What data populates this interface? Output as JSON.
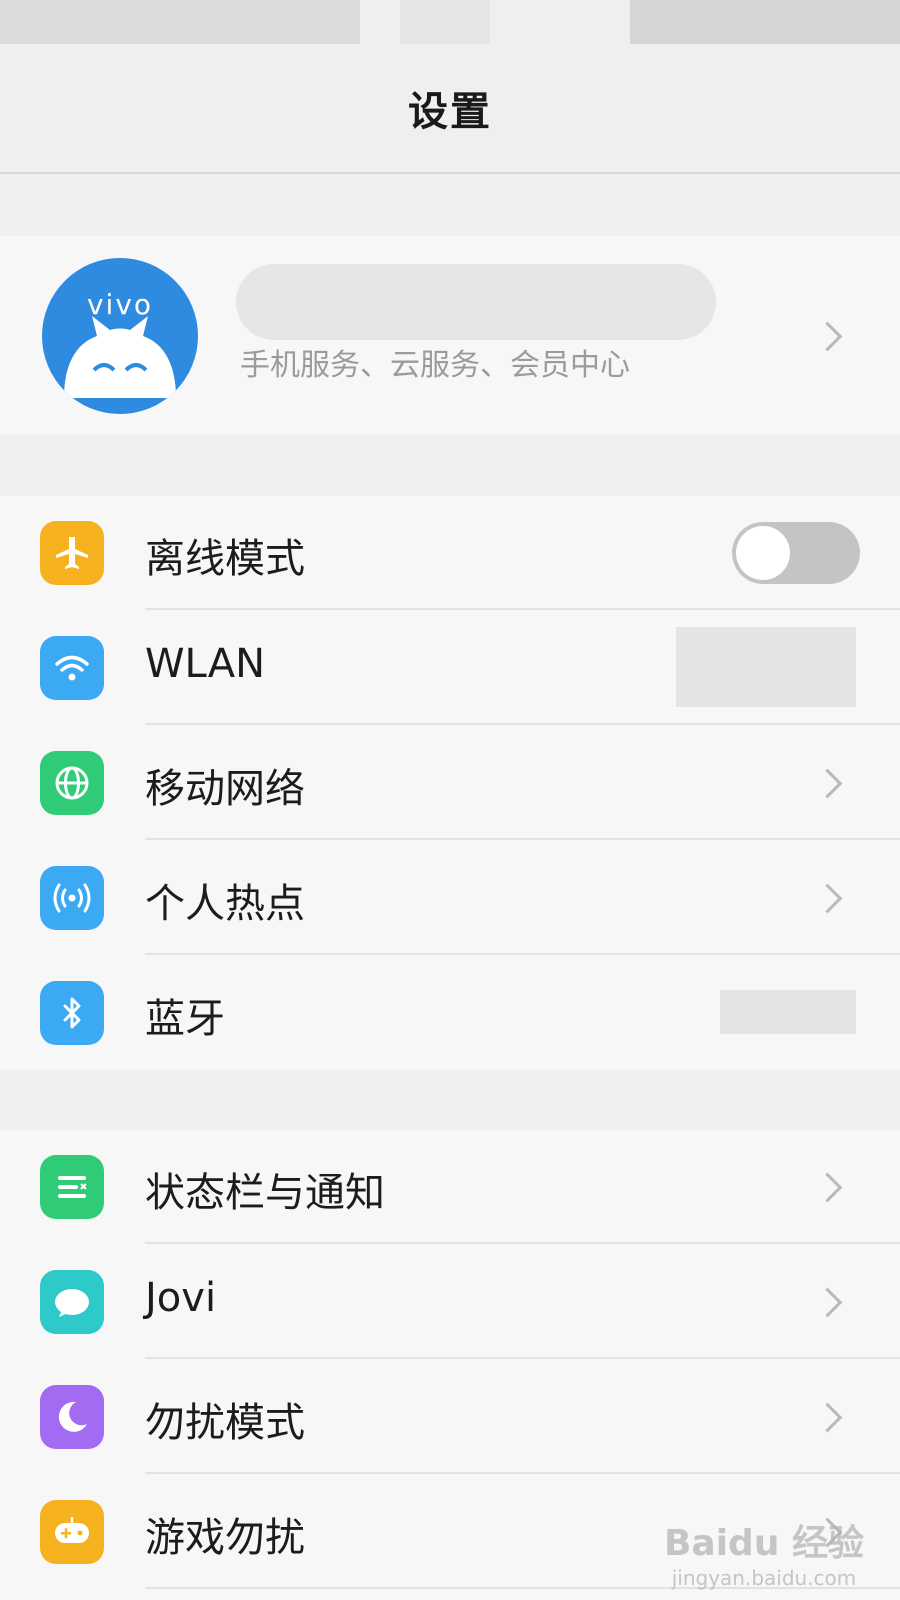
{
  "page": {
    "title": "设置"
  },
  "account": {
    "brand": "vivo",
    "subtitle": "手机服务、云服务、会员中心"
  },
  "groups": [
    {
      "rows": [
        {
          "label": "离线模式",
          "icon": "airplane-icon",
          "icon_color": "#F6B11E",
          "control": "toggle",
          "toggle_on": false
        },
        {
          "label": "WLAN",
          "icon": "wifi-icon",
          "icon_color": "#3CA9F5",
          "control": "masked-value"
        },
        {
          "label": "移动网络",
          "icon": "globe-icon",
          "icon_color": "#2FCB77",
          "control": "chevron"
        },
        {
          "label": "个人热点",
          "icon": "hotspot-icon",
          "icon_color": "#3CA9F5",
          "control": "chevron"
        },
        {
          "label": "蓝牙",
          "icon": "bluetooth-icon",
          "icon_color": "#3CA9F5",
          "control": "masked-value"
        }
      ]
    },
    {
      "rows": [
        {
          "label": "状态栏与通知",
          "icon": "notification-list-icon",
          "icon_color": "#2FCB77",
          "control": "chevron"
        },
        {
          "label": "Jovi",
          "icon": "jovi-icon",
          "icon_color": "#2EC9C9",
          "control": "chevron"
        },
        {
          "label": "勿扰模式",
          "icon": "moon-icon",
          "icon_color": "#A36BF2",
          "control": "chevron"
        },
        {
          "label": "游戏勿扰",
          "icon": "gamepad-icon",
          "icon_color": "#F6B11E",
          "control": "chevron"
        }
      ]
    }
  ],
  "watermark": {
    "top": "Baidu 经验",
    "bottom": "jingyan.baidu.com"
  }
}
